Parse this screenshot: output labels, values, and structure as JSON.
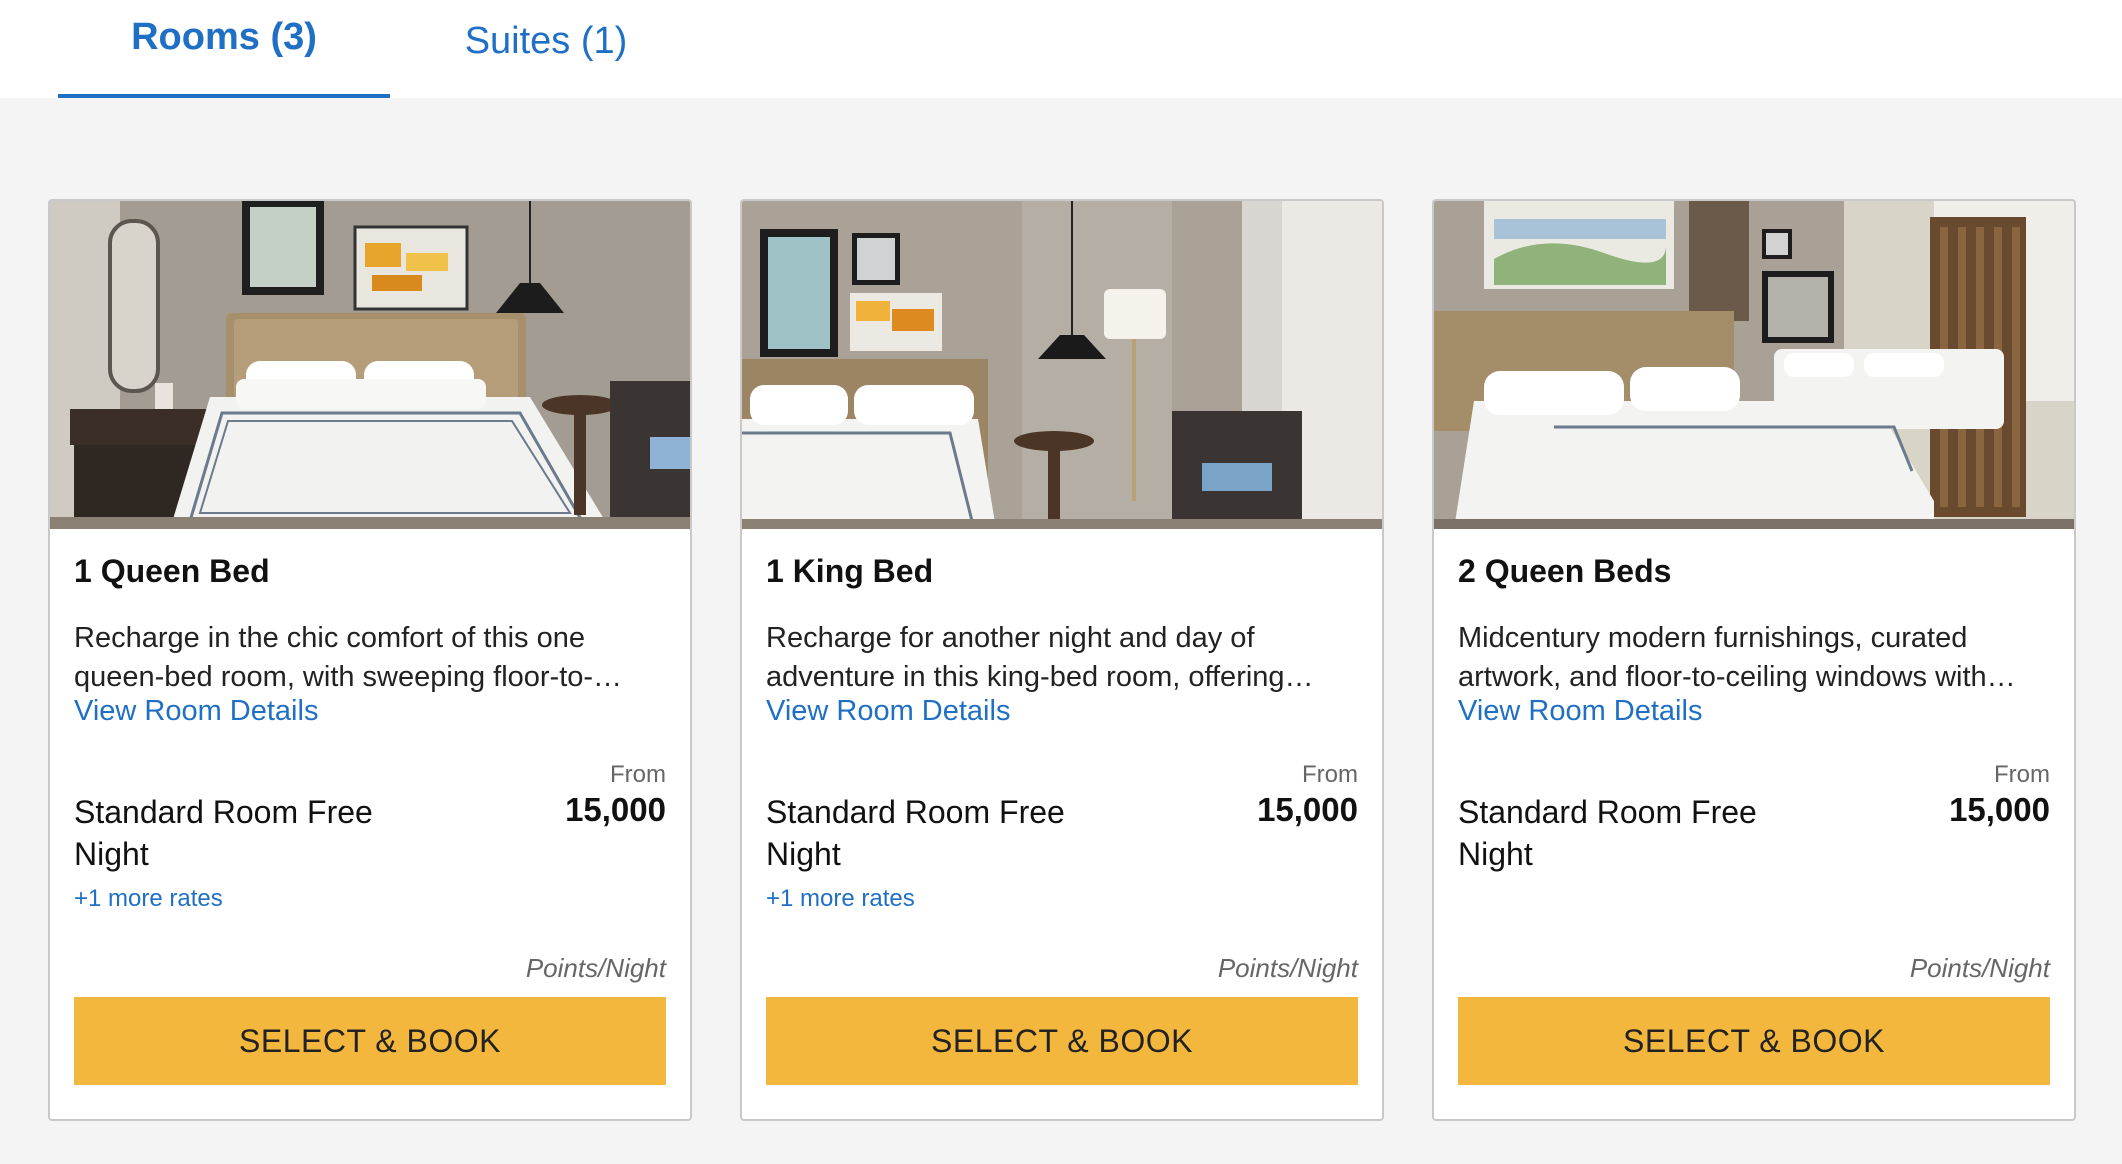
{
  "tabs": [
    {
      "label": "Rooms (3)",
      "active": true
    },
    {
      "label": "Suites (1)",
      "active": false
    }
  ],
  "accent_color": "#1f6fc5",
  "button_color": "#f3b73d",
  "rooms": [
    {
      "title": "1 Queen Bed",
      "description": "Recharge in the chic comfort of this one queen-bed room, with sweeping floor-to-…",
      "details_link": "View Room Details",
      "rate_name": "Standard Room Free Night",
      "from_label": "From",
      "points": "15,000",
      "more_rates": "+1 more rates",
      "unit_label": "Points/Night",
      "button_label": "SELECT & BOOK",
      "image": "hotel room with queen bed, wall art, pendant lamp and armchair"
    },
    {
      "title": "1 King Bed",
      "description": "Recharge for another night and day of adventure in this king-bed room, offering…",
      "details_link": "View Room Details",
      "rate_name": "Standard Room Free Night",
      "from_label": "From",
      "points": "15,000",
      "more_rates": "+1 more rates",
      "unit_label": "Points/Night",
      "button_label": "SELECT & BOOK",
      "image": "hotel room with king bed, framed art, floor lamp and lounge chair"
    },
    {
      "title": "2 Queen Beds",
      "description": "Midcentury modern furnishings, curated artwork, and floor-to-ceiling windows with…",
      "details_link": "View Room Details",
      "rate_name": "Standard Room Free Night",
      "from_label": "From",
      "points": "15,000",
      "more_rates": "",
      "unit_label": "Points/Night",
      "button_label": "SELECT & BOOK",
      "image": "hotel room with two queen beds, landscape art and wooden slat screen"
    }
  ]
}
